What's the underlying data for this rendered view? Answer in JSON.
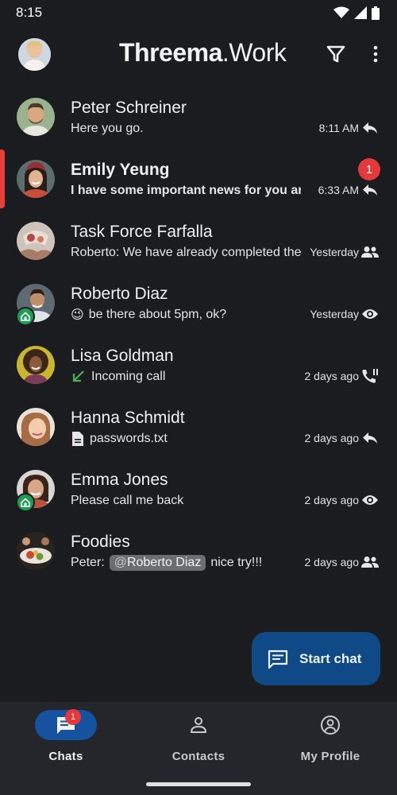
{
  "status_bar": {
    "time": "8:15"
  },
  "app_bar": {
    "brand_main": "Threema",
    "brand_sub": ".Work"
  },
  "chats": [
    {
      "name": "Peter Schreiner",
      "preview": "Here you go.",
      "time": "8:11 AM",
      "status_icon": "reply-icon",
      "unread": null,
      "bold": false,
      "work": false
    },
    {
      "name": "Emily Yeung",
      "preview": "I have some important news for you and",
      "time": "6:33 AM",
      "status_icon": "reply-icon",
      "unread": "1",
      "bold": true,
      "work": false
    },
    {
      "name": "Task Force Farfalla",
      "preview": "Roberto: We have already completed the",
      "time": "Yesterday",
      "status_icon": "group-icon",
      "unread": null,
      "bold": false,
      "work": false
    },
    {
      "name": "Roberto Diaz",
      "preview": "be there about 5pm, ok?",
      "emoji": "😉",
      "time": "Yesterday",
      "status_icon": "eye-icon",
      "unread": null,
      "bold": false,
      "work": true
    },
    {
      "name": "Lisa Goldman",
      "preview": "Incoming call",
      "time": "2 days ago",
      "status_icon": "phone-icon",
      "unread": null,
      "bold": false,
      "work": false
    },
    {
      "name": "Hanna Schmidt",
      "preview": "passwords.txt",
      "time": "2 days ago",
      "status_icon": "reply-icon",
      "unread": null,
      "bold": false,
      "work": false
    },
    {
      "name": "Emma Jones",
      "preview": "Please call me back",
      "time": "2 days ago",
      "status_icon": "eye-icon",
      "unread": null,
      "bold": false,
      "work": true
    },
    {
      "name": "Foodies",
      "preview_prefix": "Peter:",
      "mention_at": "@",
      "mention": "Roberto Diaz",
      "preview_suffix": "nice try!!!",
      "time": "2 days ago",
      "status_icon": "group-icon",
      "unread": null,
      "bold": false,
      "work": false
    }
  ],
  "fab": {
    "label": "Start chat"
  },
  "bottom_nav": [
    {
      "label": "Chats",
      "badge": "1",
      "active": true
    },
    {
      "label": "Contacts",
      "active": false
    },
    {
      "label": "My Profile",
      "active": false
    }
  ],
  "colors": {
    "accent": "#1552a0",
    "badge": "#e5383b",
    "background": "#1b1c1f",
    "work_badge": "#1f9d55"
  }
}
